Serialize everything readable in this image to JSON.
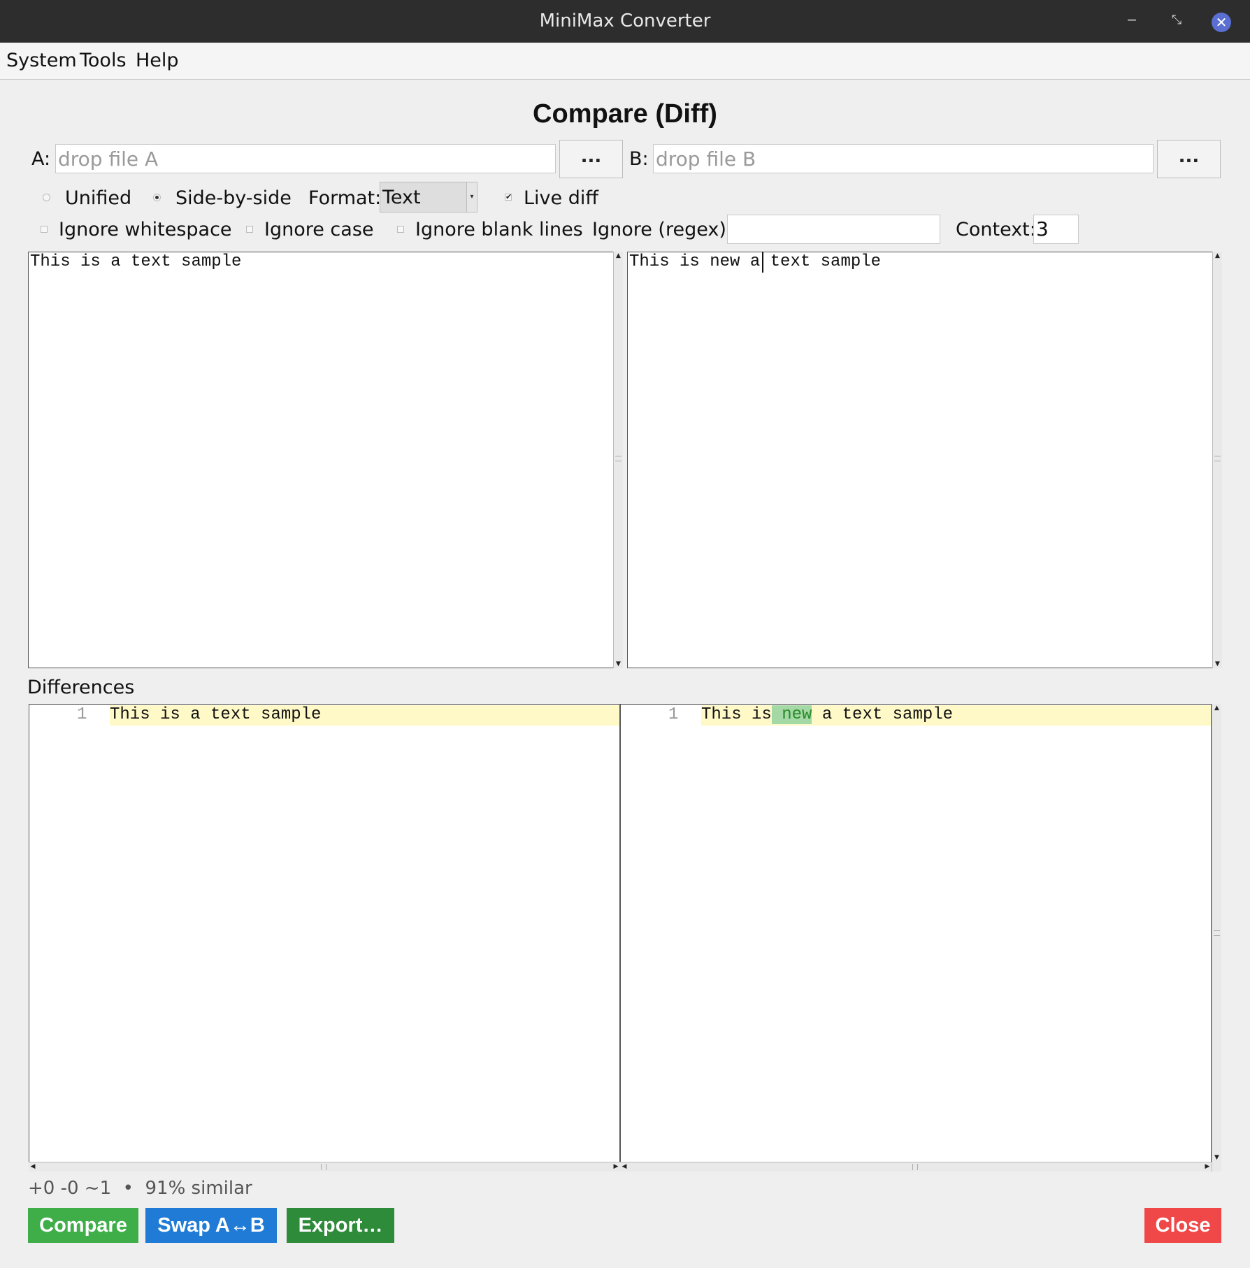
{
  "window": {
    "title": "MiniMax Converter"
  },
  "menu": {
    "items": [
      "System",
      "Tools",
      "Help"
    ]
  },
  "heading": "Compare (Diff)",
  "file_a": {
    "label": "A:",
    "placeholder": "drop file A",
    "browse": "..."
  },
  "file_b": {
    "label": "B:",
    "placeholder": "drop file B",
    "browse": "..."
  },
  "view_mode": {
    "unified": "Unified",
    "side_by_side": "Side-by-side",
    "selected": "Side-by-side"
  },
  "format": {
    "label": "Format:",
    "value": "Text"
  },
  "live_diff": {
    "label": "Live diff",
    "checked": true
  },
  "options": {
    "ignore_whitespace": {
      "label": "Ignore whitespace",
      "checked": false
    },
    "ignore_case": {
      "label": "Ignore case",
      "checked": false
    },
    "ignore_blank_lines": {
      "label": "Ignore blank lines",
      "checked": false
    },
    "ignore_regex": {
      "label": "Ignore (regex):",
      "value": ""
    },
    "context": {
      "label": "Context:",
      "value": "3"
    }
  },
  "editor_a": {
    "text": "This is a text sample"
  },
  "editor_b": {
    "text": "This is new a text sample"
  },
  "differences": {
    "title": "Differences",
    "left": {
      "line_number": "1",
      "text": "This is a text sample"
    },
    "right": {
      "line_number": "1",
      "before": "This is",
      "added": " new",
      "after": " a text sample"
    }
  },
  "status": "+0 -0 ~1  •  91% similar",
  "buttons": {
    "compare": "Compare",
    "swap": "Swap A↔B",
    "export": "Export…",
    "close": "Close"
  },
  "colors": {
    "compare": "#3fae49",
    "swap": "#1f7bd6",
    "export": "#2e8b3a",
    "close": "#f04848",
    "added_highlight": "#a4d8a4",
    "changed_line": "#fff9c8"
  }
}
